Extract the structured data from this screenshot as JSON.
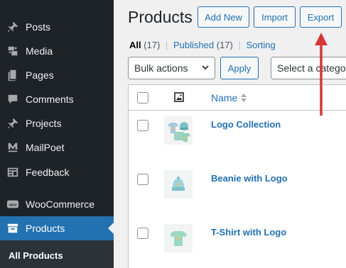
{
  "sidebar": {
    "items": [
      {
        "label": "Posts",
        "icon": "pin-icon"
      },
      {
        "label": "Media",
        "icon": "media-icon"
      },
      {
        "label": "Pages",
        "icon": "pages-icon"
      },
      {
        "label": "Comments",
        "icon": "comment-icon"
      },
      {
        "label": "Projects",
        "icon": "pin-icon"
      },
      {
        "label": "MailPoet",
        "icon": "mailpoet-icon"
      },
      {
        "label": "Feedback",
        "icon": "feedback-icon"
      },
      {
        "label": "WooCommerce",
        "icon": "woo-icon"
      },
      {
        "label": "Products",
        "icon": "archive-icon",
        "active": true
      }
    ],
    "submenu": {
      "label": "All Products"
    },
    "colors": {
      "bg": "#1d2327",
      "active": "#2271b1"
    }
  },
  "header": {
    "title": "Products",
    "buttons": {
      "add_new": "Add New",
      "import": "Import",
      "export": "Export"
    }
  },
  "filters": {
    "all": "All",
    "all_count": "(17)",
    "published": "Published",
    "published_count": "(17)",
    "sorting": "Sorting",
    "separator": "|"
  },
  "bulk": {
    "bulk_actions": "Bulk actions",
    "apply": "Apply",
    "category_placeholder": "Select a category"
  },
  "table": {
    "name_header": "Name",
    "rows": [
      {
        "name": "Logo Collection"
      },
      {
        "name": "Beanie with Logo"
      },
      {
        "name": "T-Shirt with Logo"
      }
    ]
  },
  "annotation": {
    "color": "#d63638"
  }
}
